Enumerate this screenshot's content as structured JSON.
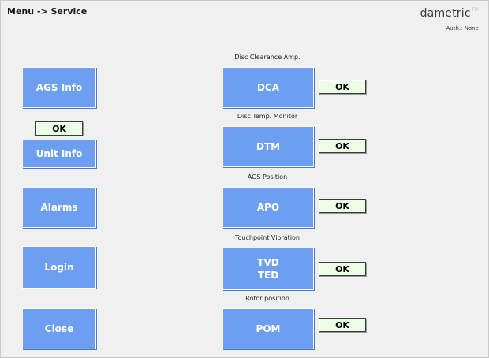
{
  "header": {
    "breadcrumb": "Menu -> Service",
    "brand": "dametric",
    "brand_mark": "TM",
    "auth": "Auth.: None"
  },
  "left_menu": {
    "ags_info": "AGS Info",
    "unit_info_status": "OK",
    "unit_info": "Unit Info",
    "alarms": "Alarms",
    "login": "Login",
    "close": "Close"
  },
  "modules": [
    {
      "caption": "Disc Clearance Amp.",
      "button": "DCA",
      "status": "OK"
    },
    {
      "caption": "Disc Temp. Monitor",
      "button": "DTM",
      "status": "OK"
    },
    {
      "caption": "AGS Position",
      "button": "APO",
      "status": "OK"
    },
    {
      "caption": "Touchpoint Vibration",
      "button": "TVD\nTED",
      "status": "OK"
    },
    {
      "caption": "Rotor position",
      "button": "POM",
      "status": "OK"
    }
  ],
  "colors": {
    "button_blue": "#6c9ff2",
    "status_ok_bg": "#ecffe6",
    "screen_bg": "#f1f0f0"
  }
}
